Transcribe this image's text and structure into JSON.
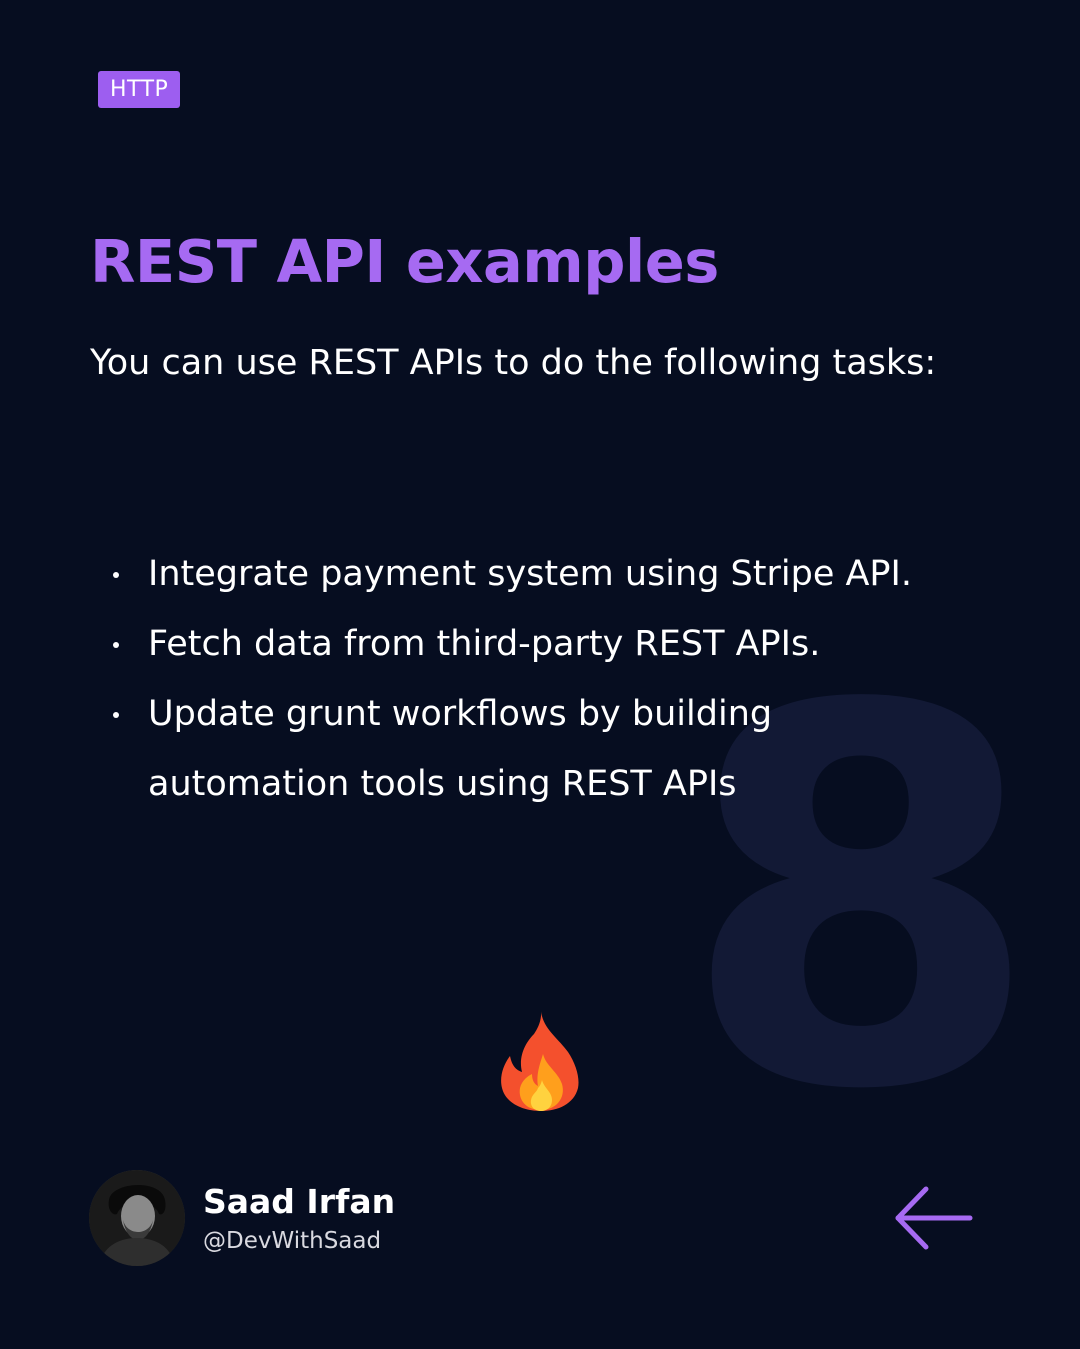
{
  "tag": {
    "label": "HTTP"
  },
  "background_number": "8",
  "title": "REST API examples",
  "intro": "You can use REST APIs to do the following tasks:",
  "bullets": [
    "Integrate payment system using Stripe API.",
    "Fetch data from third-party REST APIs.",
    "Update grunt workflows by building automation tools using REST APIs"
  ],
  "emoji": {
    "icon": "fire-icon"
  },
  "author": {
    "name": "Saad Irfan",
    "handle": "@DevWithSaad"
  },
  "navigation": {
    "icon": "arrow-left-icon"
  },
  "colors": {
    "background": "#060d20",
    "accent": "#a66af2",
    "tag_background": "#9d5ef0",
    "text": "#ffffff",
    "background_number": "#121935"
  }
}
